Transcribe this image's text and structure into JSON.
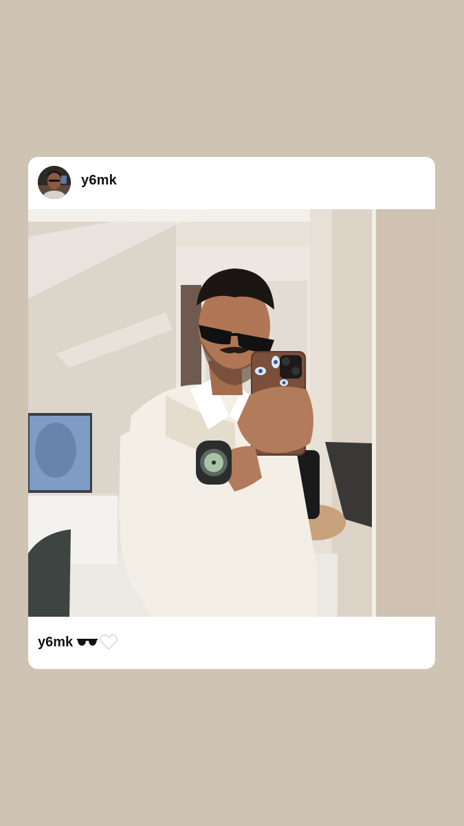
{
  "post": {
    "username": "y6mk",
    "caption_username": "y6mk",
    "caption_icons": [
      "sunglasses-icon",
      "white-heart-icon"
    ]
  },
  "colors": {
    "background": "#cfc3b3",
    "card": "#ffffff",
    "text": "#111111"
  }
}
